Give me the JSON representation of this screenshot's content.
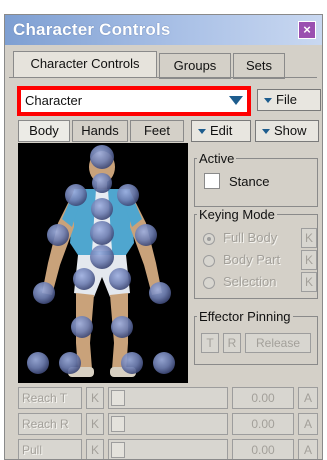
{
  "window": {
    "title": "Character Controls",
    "close_glyph": "×"
  },
  "tabs": [
    {
      "label": "Character Controls",
      "active": true
    },
    {
      "label": "Groups",
      "active": false
    },
    {
      "label": "Sets",
      "active": false
    }
  ],
  "character": {
    "selected": "Character"
  },
  "menus": {
    "file": "File",
    "edit": "Edit",
    "show": "Show"
  },
  "subtabs": [
    {
      "label": "Body",
      "active": true
    },
    {
      "label": "Hands",
      "active": false
    },
    {
      "label": "Feet",
      "active": false
    }
  ],
  "active_group": {
    "legend": "Active",
    "stance_label": "Stance",
    "stance_checked": false
  },
  "keying_mode": {
    "legend": "Keying Mode",
    "options": [
      {
        "label": "Full Body",
        "selected": true
      },
      {
        "label": "Body Part",
        "selected": false
      },
      {
        "label": "Selection",
        "selected": false
      }
    ],
    "key_label": "K"
  },
  "effector_pinning": {
    "legend": "Effector Pinning",
    "t": "T",
    "r": "R",
    "release": "Release"
  },
  "sliders": [
    {
      "label": "Reach T",
      "key": "K",
      "value": "0.00",
      "anim": "A"
    },
    {
      "label": "Reach R",
      "key": "K",
      "value": "0.00",
      "anim": "A"
    },
    {
      "label": "Pull",
      "key": "K",
      "value": "0.00",
      "anim": "A"
    }
  ],
  "colors": {
    "title_gradient_start": "#7e9fd2",
    "highlight": "#ff0000",
    "viewport_bg": "#000000",
    "effector": "#6f7fb2"
  }
}
